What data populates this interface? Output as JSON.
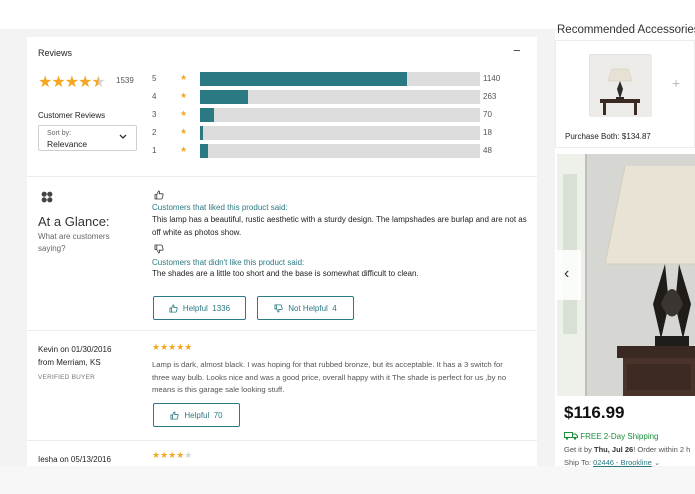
{
  "reviews": {
    "title": "Reviews",
    "collapse_glyph": "−",
    "average_rating": 4.5,
    "total_count": "1539",
    "customer_reviews_label": "Customer Reviews",
    "sort": {
      "label": "Sort by:",
      "value": "Relevance"
    },
    "histogram": [
      {
        "stars": "5",
        "count": "1140",
        "fraction": 0.74
      },
      {
        "stars": "4",
        "count": "263",
        "fraction": 0.17
      },
      {
        "stars": "3",
        "count": "70",
        "fraction": 0.05
      },
      {
        "stars": "2",
        "count": "18",
        "fraction": 0.012
      },
      {
        "stars": "1",
        "count": "48",
        "fraction": 0.03
      }
    ]
  },
  "glance": {
    "title": "At a Glance:",
    "subtitle": "What are customers saying?",
    "liked_label": "Customers that liked this product said:",
    "liked_text": "This lamp has a beautiful, rustic aesthetic with a sturdy design. The lampshades are burlap and are not as off white as photos show.",
    "disliked_label": "Customers that didn't like this product said:",
    "disliked_text": "The shades are a little too short and the base is somewhat difficult to clean.",
    "helpful_label": "Helpful",
    "helpful_count": "1336",
    "not_helpful_label": "Not Helpful",
    "not_helpful_count": "4"
  },
  "review_items": [
    {
      "author": "Kevin on 01/30/2016",
      "location": "from Merriam, KS",
      "badge": "VERIFIED BUYER",
      "rating": 5,
      "text": "Lamp is dark, almost black. I was hoping for that rubbed bronze, but its acceptable. It has a 3 switch for three way bulb. Looks nice and was a good price, overall happy with it The shade is perfect for us ,by no means is this garage sale looking stuff.",
      "helpful_label": "Helpful",
      "helpful_count": "70"
    },
    {
      "author": "Iesha on 05/13/2016",
      "rating": 4
    }
  ],
  "sidebar": {
    "recommended_title": "Recommended Accessories",
    "purchase_both": "Purchase Both: $134.87",
    "price": "$116.99",
    "shipping": "FREE 2-Day Shipping",
    "get_it_prefix": "Get it by ",
    "get_it_date": "Thu, Jul 26",
    "get_it_suffix": "! Order within 2 h",
    "ship_to_label": "Ship To: ",
    "ship_to_value": "02446 - Brookline",
    "carousel_prev_glyph": "‹"
  },
  "colors": {
    "accent": "#2b7a83",
    "star": "#f5a623",
    "shipping_green": "#1a8c3a"
  }
}
